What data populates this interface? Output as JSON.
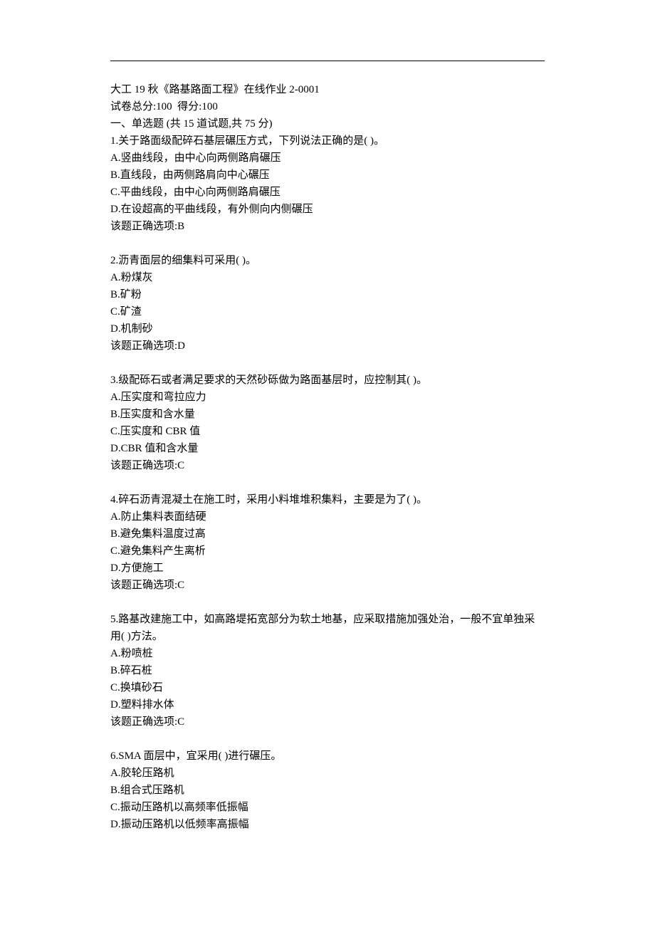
{
  "header": {
    "title": "大工 19 秋《路基路面工程》在线作业 2-0001",
    "score_line": "试卷总分:100  得分:100",
    "section": "一、单选题 (共 15 道试题,共 75 分)"
  },
  "questions": [
    {
      "stem": "1.关于路面级配碎石基层碾压方式，下列说法正确的是( )。",
      "opts": [
        "A.竖曲线段，由中心向两侧路肩碾压",
        "B.直线段，由两侧路肩向中心碾压",
        "C.平曲线段，由中心向两侧路肩碾压",
        "D.在设超高的平曲线段，有外侧向内侧碾压"
      ],
      "answer": "该题正确选项:B"
    },
    {
      "stem": "2.沥青面层的细集料可采用( )。",
      "opts": [
        "A.粉煤灰",
        "B.矿粉",
        "C.矿渣",
        "D.机制砂"
      ],
      "answer": "该题正确选项:D"
    },
    {
      "stem": "3.级配砾石或者满足要求的天然砂砾做为路面基层时，应控制其( )。",
      "opts": [
        "A.压实度和弯拉应力",
        "B.压实度和含水量",
        "C.压实度和 CBR 值",
        "D.CBR 值和含水量"
      ],
      "answer": "该题正确选项:C"
    },
    {
      "stem": "4.碎石沥青混凝土在施工时，采用小料堆堆积集料，主要是为了( )。",
      "opts": [
        "A.防止集料表面结硬",
        "B.避免集料温度过高",
        "C.避免集料产生离析",
        "D.方便施工"
      ],
      "answer": "该题正确选项:C"
    },
    {
      "stem": "5.路基改建施工中，如高路堤拓宽部分为软土地基，应采取措施加强处治，一般不宜单独采用( )方法。",
      "opts": [
        "A.粉喷桩",
        "B.碎石桩",
        "C.换填砂石",
        "D.塑料排水体"
      ],
      "answer": "该题正确选项:C"
    },
    {
      "stem": "6.SMA 面层中，宜采用( )进行碾压。",
      "opts": [
        "A.胶轮压路机",
        "B.组合式压路机",
        "C.振动压路机以高频率低振幅",
        "D.振动压路机以低频率高振幅"
      ],
      "answer": ""
    }
  ]
}
